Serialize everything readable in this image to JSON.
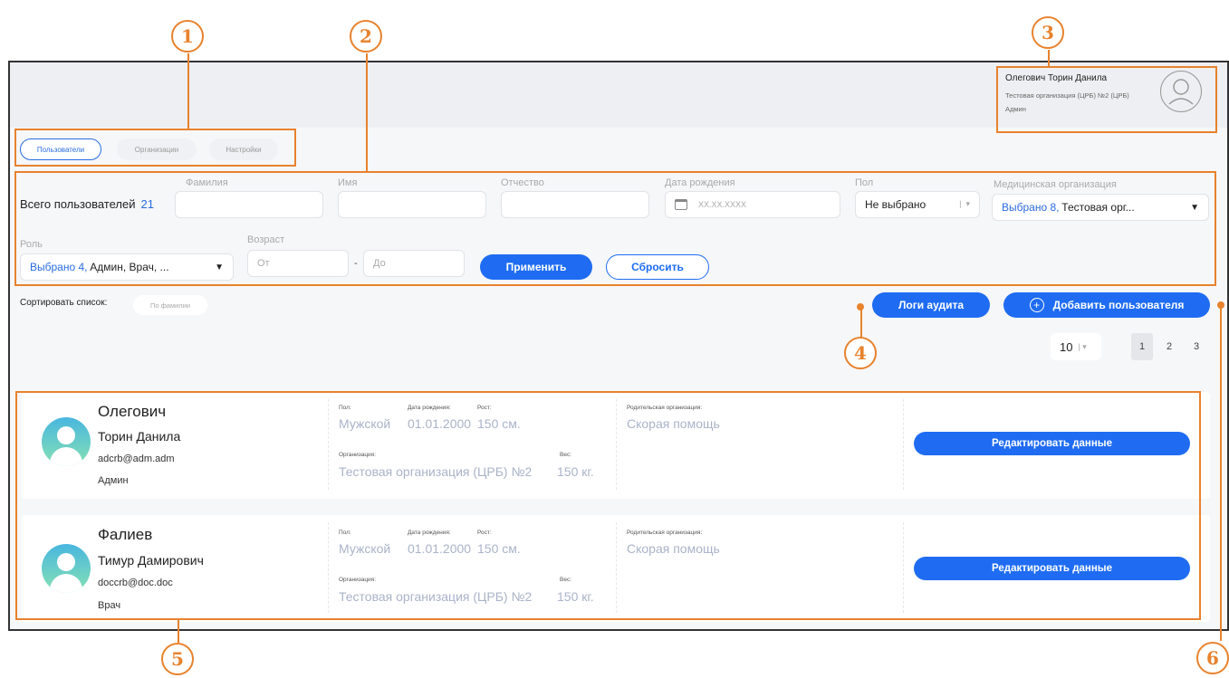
{
  "callouts": [
    "1",
    "2",
    "3",
    "4",
    "5",
    "6"
  ],
  "profile": {
    "name": "Олегович Торин Данила",
    "organization": "Тестовая организация (ЦРБ) №2 (ЦРБ)",
    "role": "Админ"
  },
  "tabs": [
    {
      "label": "Пользователи",
      "active": true
    },
    {
      "label": "Организации",
      "active": false
    },
    {
      "label": "Настройки",
      "active": false
    }
  ],
  "filters": {
    "total_label": "Всего пользователей",
    "total_count": "21",
    "last_name_label": "Фамилия",
    "first_name_label": "Имя",
    "patronymic_label": "Отчество",
    "birth_date_label": "Дата рождения",
    "birth_date_placeholder": "XX.XX.XXXX",
    "gender_label": "Пол",
    "gender_value": "Не выбрано",
    "med_org_label": "Медицинская организация",
    "med_org_selected": "Выбрано 8,",
    "med_org_value": "Тестовая орг...",
    "role_label": "Роль",
    "role_selected": "Выбрано 4,",
    "role_value": "Админ, Врач, ...",
    "age_label": "Возраст",
    "age_from_placeholder": "От",
    "age_separator": "-",
    "age_to_placeholder": "До",
    "apply_label": "Применить",
    "reset_label": "Сбросить"
  },
  "sort": {
    "label": "Сортировать список:",
    "value": "По фамилии"
  },
  "actions": {
    "audit_logs": "Логи аудита",
    "add_user": "Добавить пользователя"
  },
  "pagination": {
    "page_size": "10",
    "pages": [
      "1",
      "2",
      "3"
    ],
    "current": "1"
  },
  "field_labels": {
    "gender": "Пол:",
    "birth_date": "Дата рождения:",
    "height": "Рост:",
    "organization": "Организация:",
    "weight": "Вес:",
    "parent_org": "Родительская организация:",
    "edit": "Редактировать данные"
  },
  "users": [
    {
      "last_name": "Олегович",
      "first_name": "Торин Данила",
      "email": "adcrb@adm.adm",
      "role": "Админ",
      "gender": "Мужской",
      "birth_date": "01.01.2000",
      "height": "150 см.",
      "organization": "Тестовая организация (ЦРБ) №2",
      "weight": "150 кг.",
      "parent_org": "Скорая помощь"
    },
    {
      "last_name": "Фалиев",
      "first_name": "Тимур Дамирович",
      "email": "doccrb@doc.doc",
      "role": "Врач",
      "gender": "Мужской",
      "birth_date": "01.01.2000",
      "height": "150 см.",
      "organization": "Тестовая организация (ЦРБ) №2",
      "weight": "150 кг.",
      "parent_org": "Скорая помощь"
    }
  ],
  "colors": {
    "accent": "#1f6cf2",
    "callout": "#e8822d"
  }
}
